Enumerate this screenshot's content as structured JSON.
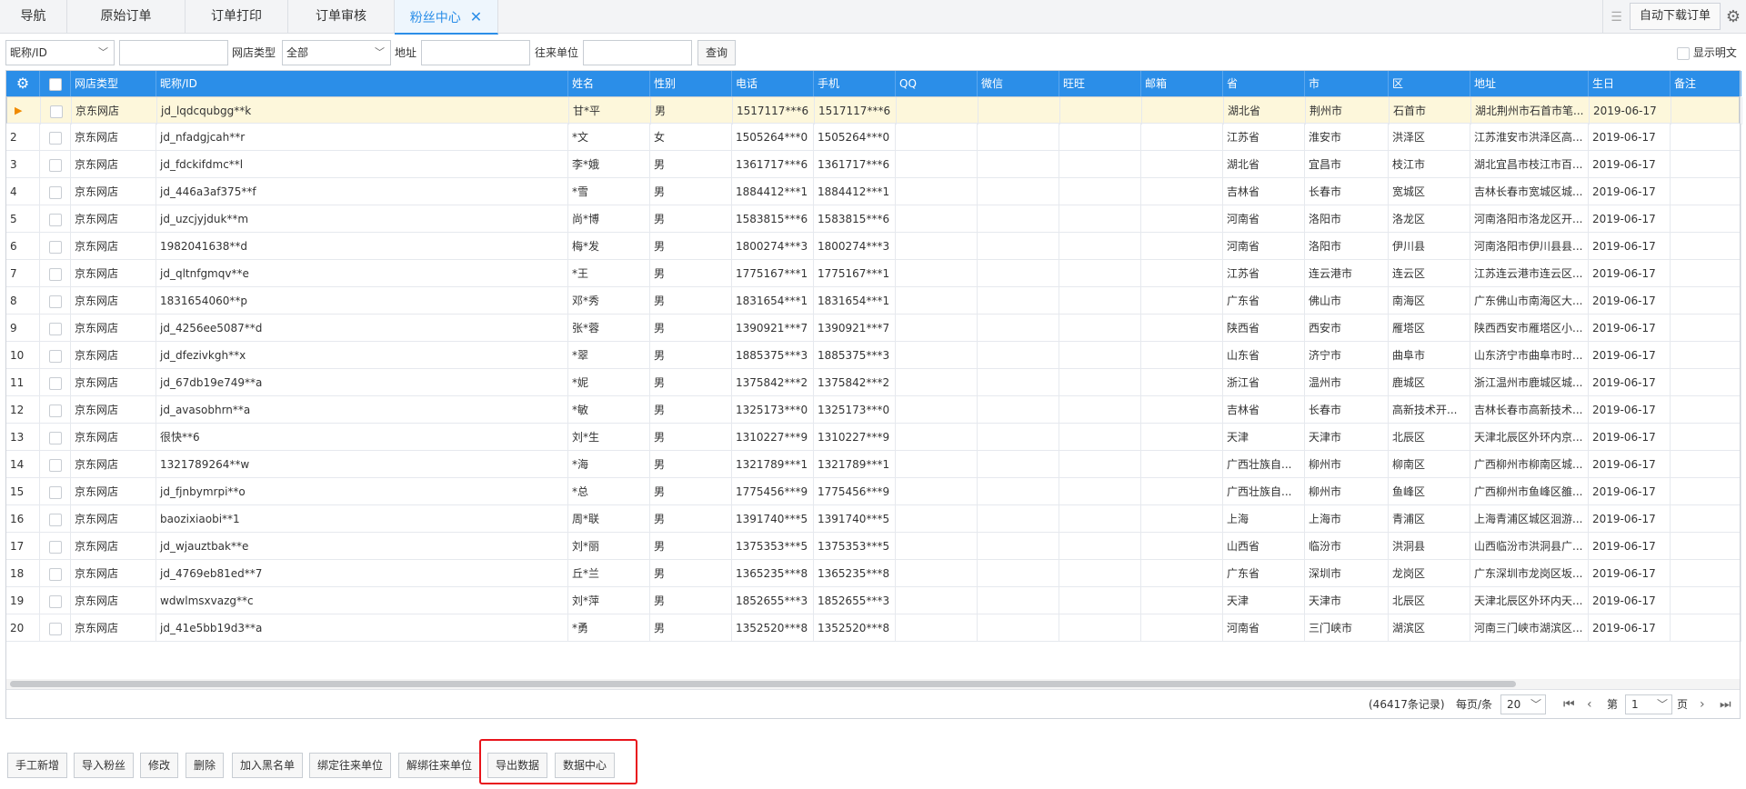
{
  "tabs": [
    {
      "label": "导航",
      "active": false
    },
    {
      "label": "原始订单",
      "active": false
    },
    {
      "label": "订单打印",
      "active": false
    },
    {
      "label": "订单审核",
      "active": false
    },
    {
      "label": "粉丝中心",
      "active": true
    }
  ],
  "toolbar": {
    "auto_download_label": "自动下载订单"
  },
  "search": {
    "field_select": "昵称/ID",
    "keyword_value": "",
    "shop_type_label": "网店类型",
    "shop_type_value": "全部",
    "address_label": "地址",
    "address_value": "",
    "partner_label": "往来单位",
    "partner_value": "",
    "query_label": "查询",
    "show_plain_label": "显示明文"
  },
  "table": {
    "columns": [
      "网店类型",
      "昵称/ID",
      "姓名",
      "性别",
      "电话",
      "手机",
      "QQ",
      "微信",
      "旺旺",
      "邮箱",
      "省",
      "市",
      "区",
      "地址",
      "生日",
      "备注"
    ],
    "selected_row": 1,
    "rows": [
      [
        "1",
        "京东网店",
        "jd_lqdcqubgg**k",
        "甘*平",
        "男",
        "1517117***6",
        "1517117***6",
        "",
        "",
        "",
        "",
        "湖北省",
        "荆州市",
        "石首市",
        "湖北荆州市石首市笔...",
        "2019-06-17",
        ""
      ],
      [
        "2",
        "京东网店",
        "jd_nfadgjcah**r",
        "*文",
        "女",
        "1505264***0",
        "1505264***0",
        "",
        "",
        "",
        "",
        "江苏省",
        "淮安市",
        "洪泽区",
        "江苏淮安市洪泽区高...",
        "2019-06-17",
        ""
      ],
      [
        "3",
        "京东网店",
        "jd_fdckifdmc**l",
        "李*娥",
        "男",
        "1361717***6",
        "1361717***6",
        "",
        "",
        "",
        "",
        "湖北省",
        "宜昌市",
        "枝江市",
        "湖北宜昌市枝江市百...",
        "2019-06-17",
        ""
      ],
      [
        "4",
        "京东网店",
        "jd_446a3af375**f",
        "*雪",
        "男",
        "1884412***1",
        "1884412***1",
        "",
        "",
        "",
        "",
        "吉林省",
        "长春市",
        "宽城区",
        "吉林长春市宽城区城...",
        "2019-06-17",
        ""
      ],
      [
        "5",
        "京东网店",
        "jd_uzcjyjduk**m",
        "尚*博",
        "男",
        "1583815***6",
        "1583815***6",
        "",
        "",
        "",
        "",
        "河南省",
        "洛阳市",
        "洛龙区",
        "河南洛阳市洛龙区开...",
        "2019-06-17",
        ""
      ],
      [
        "6",
        "京东网店",
        "1982041638**d",
        "梅*发",
        "男",
        "1800274***3",
        "1800274***3",
        "",
        "",
        "",
        "",
        "河南省",
        "洛阳市",
        "伊川县",
        "河南洛阳市伊川县县...",
        "2019-06-17",
        ""
      ],
      [
        "7",
        "京东网店",
        "jd_qltnfgmqv**e",
        "*王",
        "男",
        "1775167***1",
        "1775167***1",
        "",
        "",
        "",
        "",
        "江苏省",
        "连云港市",
        "连云区",
        "江苏连云港市连云区...",
        "2019-06-17",
        ""
      ],
      [
        "8",
        "京东网店",
        "1831654060**p",
        "邓*秀",
        "男",
        "1831654***1",
        "1831654***1",
        "",
        "",
        "",
        "",
        "广东省",
        "佛山市",
        "南海区",
        "广东佛山市南海区大...",
        "2019-06-17",
        ""
      ],
      [
        "9",
        "京东网店",
        "jd_4256ee5087**d",
        "张*蓉",
        "男",
        "1390921***7",
        "1390921***7",
        "",
        "",
        "",
        "",
        "陕西省",
        "西安市",
        "雁塔区",
        "陕西西安市雁塔区小...",
        "2019-06-17",
        ""
      ],
      [
        "10",
        "京东网店",
        "jd_dfezivkgh**x",
        "*翠",
        "男",
        "1885375***3",
        "1885375***3",
        "",
        "",
        "",
        "",
        "山东省",
        "济宁市",
        "曲阜市",
        "山东济宁市曲阜市时...",
        "2019-06-17",
        ""
      ],
      [
        "11",
        "京东网店",
        "jd_67db19e749**a",
        "*妮",
        "男",
        "1375842***2",
        "1375842***2",
        "",
        "",
        "",
        "",
        "浙江省",
        "温州市",
        "鹿城区",
        "浙江温州市鹿城区城...",
        "2019-06-17",
        ""
      ],
      [
        "12",
        "京东网店",
        "jd_avasobhrn**a",
        "*敏",
        "男",
        "1325173***0",
        "1325173***0",
        "",
        "",
        "",
        "",
        "吉林省",
        "长春市",
        "高新技术开...",
        "吉林长春市高新技术...",
        "2019-06-17",
        ""
      ],
      [
        "13",
        "京东网店",
        "很快**6",
        "刘*生",
        "男",
        "1310227***9",
        "1310227***9",
        "",
        "",
        "",
        "",
        "天津",
        "天津市",
        "北辰区",
        "天津北辰区外环内京...",
        "2019-06-17",
        ""
      ],
      [
        "14",
        "京东网店",
        "1321789264**w",
        "*海",
        "男",
        "1321789***1",
        "1321789***1",
        "",
        "",
        "",
        "",
        "广西壮族自...",
        "柳州市",
        "柳南区",
        "广西柳州市柳南区城...",
        "2019-06-17",
        ""
      ],
      [
        "15",
        "京东网店",
        "jd_fjnbymrpi**o",
        "*总",
        "男",
        "1775456***9",
        "1775456***9",
        "",
        "",
        "",
        "",
        "广西壮族自...",
        "柳州市",
        "鱼峰区",
        "广西柳州市鱼峰区雒...",
        "2019-06-17",
        ""
      ],
      [
        "16",
        "京东网店",
        "baozixiaobi**1",
        "周*联",
        "男",
        "1391740***5",
        "1391740***5",
        "",
        "",
        "",
        "",
        "上海",
        "上海市",
        "青浦区",
        "上海青浦区城区洄游...",
        "2019-06-17",
        ""
      ],
      [
        "17",
        "京东网店",
        "jd_wjauztbak**e",
        "刘*丽",
        "男",
        "1375353***5",
        "1375353***5",
        "",
        "",
        "",
        "",
        "山西省",
        "临汾市",
        "洪洞县",
        "山西临汾市洪洞县广...",
        "2019-06-17",
        ""
      ],
      [
        "18",
        "京东网店",
        "jd_4769eb81ed**7",
        "丘*兰",
        "男",
        "1365235***8",
        "1365235***8",
        "",
        "",
        "",
        "",
        "广东省",
        "深圳市",
        "龙岗区",
        "广东深圳市龙岗区坂...",
        "2019-06-17",
        ""
      ],
      [
        "19",
        "京东网店",
        "wdwlmsxvazg**c",
        "刘*萍",
        "男",
        "1852655***3",
        "1852655***3",
        "",
        "",
        "",
        "",
        "天津",
        "天津市",
        "北辰区",
        "天津北辰区外环内天...",
        "2019-06-17",
        ""
      ],
      [
        "20",
        "京东网店",
        "jd_41e5bb19d3**a",
        "*勇",
        "男",
        "1352520***8",
        "1352520***8",
        "",
        "",
        "",
        "",
        "河南省",
        "三门峡市",
        "湖滨区",
        "河南三门峡市湖滨区...",
        "2019-06-17",
        ""
      ]
    ]
  },
  "pager": {
    "records": "(46417条记录)",
    "per_page_label": "每页/条",
    "per_page_value": "20",
    "page_prefix": "第",
    "page_value": "1",
    "page_suffix": "页"
  },
  "bottom_buttons": [
    "手工新增",
    "导入粉丝",
    "修改",
    "删除",
    "加入黑名单",
    "绑定往来单位",
    "解绑往来单位",
    "导出数据",
    "数据中心"
  ],
  "colors": {
    "accent": "#2b8ee8",
    "selected_row": "#fdf7db",
    "highlight_box": "#e8141b",
    "row_marker": "#f08a00"
  }
}
